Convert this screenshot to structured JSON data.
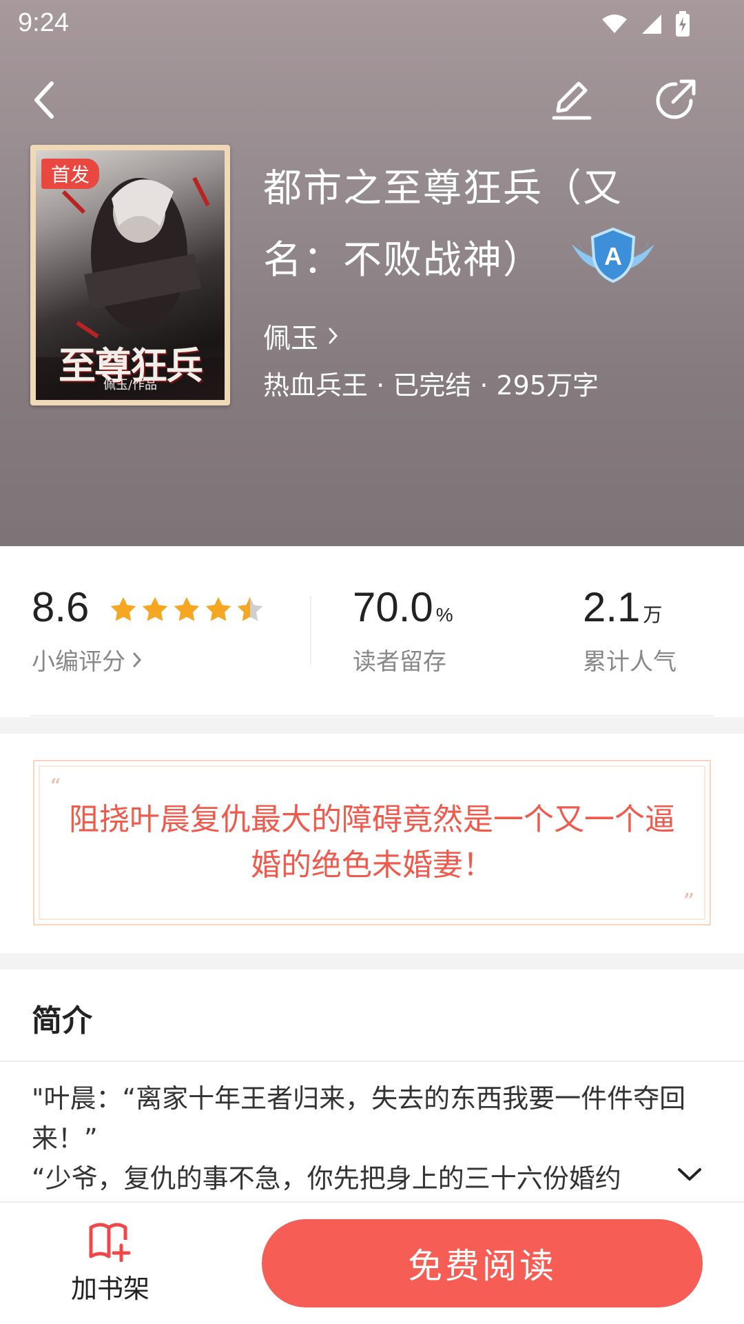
{
  "status_bar": {
    "time": "9:24"
  },
  "header": {
    "icons": [
      "back-arrow-icon",
      "edit-pencil-icon",
      "share-icon"
    ]
  },
  "book": {
    "cover": {
      "badge": "首发",
      "title": "至尊狂兵",
      "author": "佩玉/作品"
    },
    "title": "都市之至尊狂兵（又名：不败战神）",
    "rank_badge": "A",
    "author": "佩玉",
    "meta": "热血兵王 · 已完结 · 295万字"
  },
  "stats": {
    "rating": {
      "value": "8.6",
      "label": "小编评分",
      "stars": 4.5
    },
    "retention": {
      "value": "70.0",
      "unit": "%",
      "label": "读者留存"
    },
    "popularity": {
      "value": "2.1",
      "unit": "万",
      "label": "累计人气"
    }
  },
  "quote": {
    "text": "阻挠叶晨复仇最大的障碍竟然是一个又一个逼婚的绝色未婚妻！",
    "open_mark": "“",
    "close_mark": "”"
  },
  "intro": {
    "title": "简介",
    "lines": [
      "\"叶晨：“离家十年王者归来，失去的东西我要一件件夺回来！”",
      "“少爷，复仇的事不急，你先把身上的三十六份婚约"
    ]
  },
  "bottom_bar": {
    "shelf_label": "加书架",
    "read_label": "免费阅读"
  },
  "colors": {
    "accent": "#f65d55",
    "quote_text": "#ef5a4c",
    "star": "#f5a623"
  }
}
